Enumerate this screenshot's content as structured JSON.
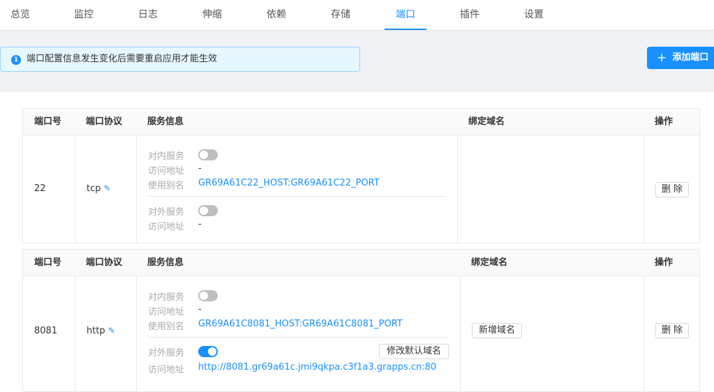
{
  "tabs": [
    {
      "label": "总览"
    },
    {
      "label": "监控"
    },
    {
      "label": "日志"
    },
    {
      "label": "伸缩"
    },
    {
      "label": "依赖"
    },
    {
      "label": "存储"
    },
    {
      "label": "端口",
      "active": true
    },
    {
      "label": "插件"
    },
    {
      "label": "设置"
    }
  ],
  "alert": {
    "icon": "1",
    "text": "端口配置信息发生变化后需要重启应用才能生效"
  },
  "add_button": {
    "label": "添加端口",
    "icon": "plus-icon"
  },
  "columns": {
    "port": "端口号",
    "protocol": "端口协议",
    "service": "服务信息",
    "domain": "绑定域名",
    "action": "操作"
  },
  "colors": {
    "accent": "#1890ff",
    "toggle_off": "#bfbfbf"
  },
  "ports": [
    {
      "port": "22",
      "protocol": "tcp",
      "inner": {
        "label": "对内服务",
        "enabled": false,
        "addr_label": "访问地址",
        "addr": "-",
        "alias_label": "使用别名",
        "alias": "GR69A61C22_HOST:GR69A61C22_PORT"
      },
      "outer": {
        "label": "对外服务",
        "enabled": false,
        "addr_label": "访问地址",
        "addr": "-"
      },
      "delete_label": "删 除"
    },
    {
      "port": "8081",
      "protocol": "http",
      "inner": {
        "label": "对内服务",
        "enabled": false,
        "addr_label": "访问地址",
        "addr": "-",
        "alias_label": "使用别名",
        "alias": "GR69A61C8081_HOST:GR69A61C8081_PORT"
      },
      "outer": {
        "label": "对外服务",
        "enabled": true,
        "addr_label": "访问地址",
        "addr": "http://8081.gr69a61c.jmi9qkpa.c3f1a3.grapps.cn:80",
        "modify_label": "修改默认域名"
      },
      "add_domain_label": "新增域名",
      "delete_label": "删 除"
    }
  ]
}
